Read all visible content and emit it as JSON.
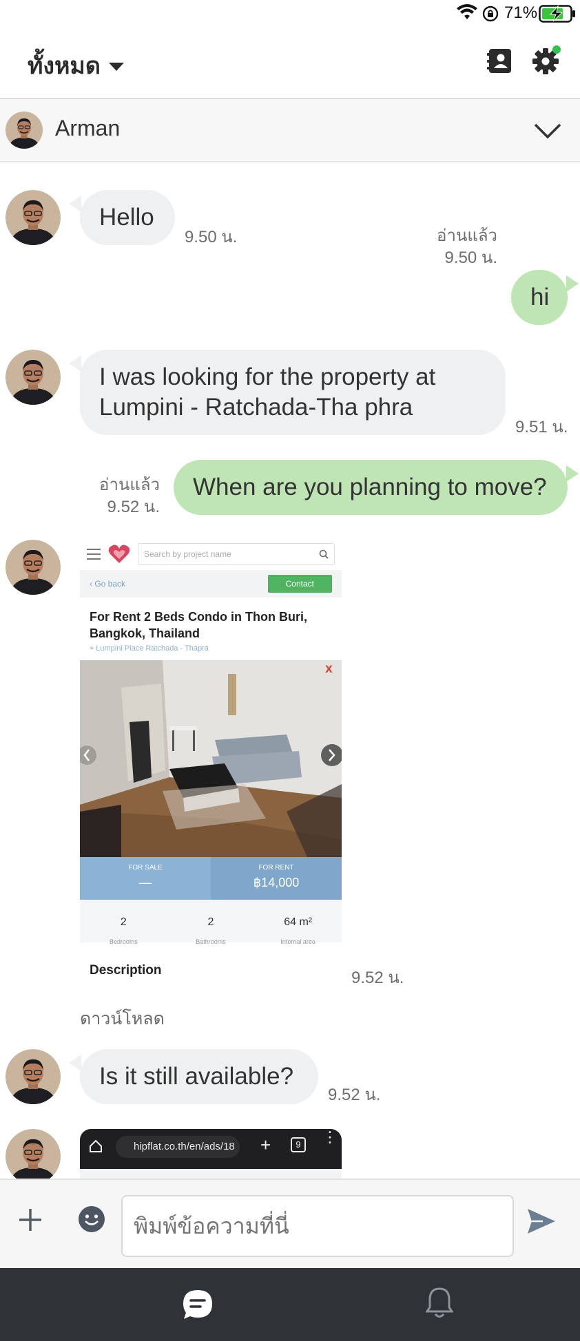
{
  "status_bar": {
    "battery_percent": "71%",
    "icons": [
      "wifi-icon",
      "rotation-lock-icon",
      "battery-charging-icon"
    ]
  },
  "header": {
    "filter_label": "ทั้งหมด",
    "icons": [
      "chevron-down-icon",
      "contacts-icon",
      "gear-icon"
    ],
    "notification_dot_color": "#35c14f"
  },
  "chat": {
    "contact_name": "Arman"
  },
  "messages": [
    {
      "direction": "in",
      "text": "Hello",
      "time": "9.50 น."
    },
    {
      "direction": "out",
      "text": "hi",
      "read": "อ่านแล้ว",
      "time": "9.50 น."
    },
    {
      "direction": "in",
      "lines": [
        "I was looking for the property at",
        "Lumpini - Ratchada-Tha phra"
      ],
      "time": "9.51 น."
    },
    {
      "direction": "out",
      "text": "When are you planning to move?",
      "read": "อ่านแล้ว",
      "time": "9.52 น."
    },
    {
      "direction": "in",
      "type": "image",
      "time": "9.52 น.",
      "download_label": "ดาวน์โหลด"
    },
    {
      "direction": "in",
      "text": "Is it still available?",
      "time": "9.52 น."
    },
    {
      "direction": "in",
      "type": "image"
    }
  ],
  "listing_card": {
    "search_placeholder": "Search by project name",
    "back_label": "Go back",
    "contact_label": "Contact",
    "title_line1": "For Rent 2 Beds Condo in Thon Buri,",
    "title_line2": "Bangkok, Thailand",
    "location": "Lumpini Place Ratchada - Thapra",
    "sale_label": "FOR SALE",
    "sale_value": "—",
    "rent_label": "FOR RENT",
    "rent_value": "฿14,000",
    "bedrooms_value": "2",
    "bedrooms_label": "Bedrooms",
    "bathrooms_value": "2",
    "bathrooms_label": "Bathrooms",
    "area_value": "64 m²",
    "area_label": "Internal area",
    "description_label": "Description"
  },
  "screenshot_card": {
    "url": "hipflat.co.th/en/ads/18",
    "tab_count": "9"
  },
  "composer": {
    "placeholder": "พิมพ์ข้อความที่นี่",
    "icons": [
      "plus-icon",
      "emoji-icon",
      "send-icon"
    ]
  },
  "bottom_nav": {
    "icons": [
      "chat-icon",
      "bell-icon"
    ]
  },
  "colors": {
    "outgoing_bubble": "#bfe5b5",
    "incoming_bubble": "#eff0f2",
    "bottom_nav": "#2f3338",
    "accent_send": "#6b7f93"
  }
}
